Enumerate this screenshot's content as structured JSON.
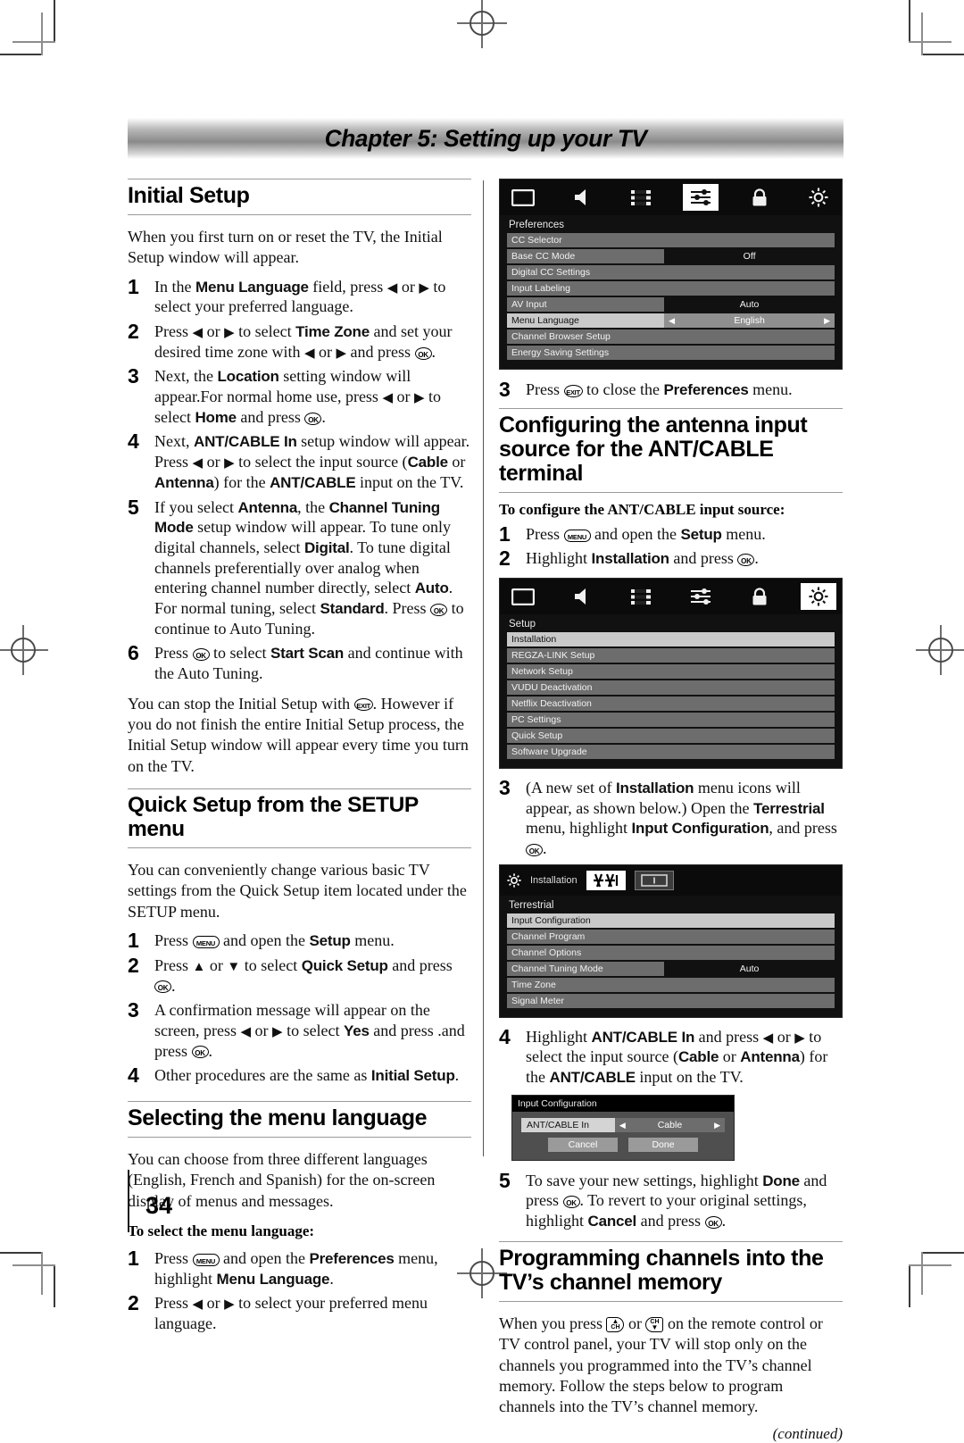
{
  "chapter": {
    "title": "Chapter 5: Setting up your TV"
  },
  "page": {
    "number": "34",
    "continued": "(continued)"
  },
  "left": {
    "section1": {
      "heading": "Initial Setup",
      "intro": "When you first turn on or reset the TV, the Initial Setup window will appear.",
      "steps": [
        {
          "n": "1",
          "html": "In the <b>Menu Language</b> field, press <span class=\"arrow\">◀</span> or <span class=\"arrow\">▶</span> to select  your preferred language."
        },
        {
          "n": "2",
          "html": "Press <span class=\"arrow\">◀</span> or <span class=\"arrow\">▶</span> to select <b>Time Zone</b> and set your desired time zone with <span class=\"arrow\">◀</span> or <span class=\"arrow\">▶</span> and press <span class=\"key ok\">OK</span>."
        },
        {
          "n": "3",
          "html": "Next, the <b>Location</b> setting window will appear.For normal home use, press <span class=\"arrow\">◀</span> or <span class=\"arrow\">▶</span> to select <b>Home</b> and press <span class=\"key ok\">OK</span>."
        },
        {
          "n": "4",
          "html": "Next, <b>ANT/CABLE In</b> setup window will appear. Press <span class=\"arrow\">◀</span> or <span class=\"arrow\">▶</span> to select the input source (<b>Cable</b> or <b>Antenna</b>) for the <b>ANT/CABLE</b> input on the TV."
        },
        {
          "n": "5",
          "html": "If you select <b>Antenna</b>, the <b>Channel Tuning Mode</b> setup window will appear. To tune only digital channels, select <b>Digital</b>. To tune digital channels preferentially over analog when entering channel number directly, select <b>Auto</b>. For normal tuning, select <b>Standard</b>. Press <span class=\"key ok\">OK</span> to continue to Auto Tuning."
        },
        {
          "n": "6",
          "html": "Press <span class=\"key ok\">OK</span> to select <b>Start Scan</b> and continue with the Auto Tuning."
        }
      ],
      "outro": "You can stop the Initial Setup with <span class=\"key exit\">EXIT</span>. However if you do not finish the entire Initial Setup process, the Initial Setup window will appear every time you turn on the TV."
    },
    "section2": {
      "heading": "Quick Setup from the SETUP menu",
      "intro": "You can conveniently change various basic TV settings from the Quick Setup item located under the SETUP menu.",
      "steps": [
        {
          "n": "1",
          "html": "Press <span class=\"key menu\">MENU</span> and open the <b>Setup</b> menu."
        },
        {
          "n": "2",
          "html": "Press <span class=\"arrow\">▲</span> or <span class=\"arrow\">▼</span> to select <b>Quick Setup</b> and press <span class=\"key ok\">OK</span>."
        },
        {
          "n": "3",
          "html": "A confirmation message will appear on the screen, press <span class=\"arrow\">◀</span> or <span class=\"arrow\">▶</span> to select <b>Yes</b> and press .and press <span class=\"key ok\">OK</span>."
        },
        {
          "n": "4",
          "html": "Other procedures are the same as <b>Initial Setup</b>."
        }
      ]
    },
    "section3": {
      "heading": "Selecting the menu language",
      "intro": "You can choose from three different languages (English, French and Spanish) for the on-screen display of menus and messages.",
      "subheading": "To select the menu language:",
      "steps": [
        {
          "n": "1",
          "html": "Press <span class=\"key menu\">MENU</span> and open the <b>Preferences</b> menu, highlight <b>Menu Language</b>."
        },
        {
          "n": "2",
          "html": "Press <span class=\"arrow\">◀</span> or <span class=\"arrow\">▶</span> to select your preferred menu language."
        }
      ]
    }
  },
  "right": {
    "preferences_osd": {
      "title": "Preferences",
      "icons": [
        "picture-icon",
        "sound-icon",
        "channel-icon",
        "preferences-icon",
        "locks-icon",
        "setup-icon"
      ],
      "selected_icon_index": 3,
      "rows": [
        {
          "label": "CC Selector",
          "value": ""
        },
        {
          "label": "Base CC Mode",
          "value": "Off"
        },
        {
          "label": "Digital CC Settings",
          "value": ""
        },
        {
          "label": "Input Labeling",
          "value": ""
        },
        {
          "label": "AV Input",
          "value": "Auto"
        },
        {
          "label": "Menu Language",
          "value": "English",
          "highlighted": true,
          "arrows": true
        },
        {
          "label": "Channel Browser Setup",
          "value": ""
        },
        {
          "label": "Energy Saving Settings",
          "value": ""
        }
      ]
    },
    "step3_prefs": {
      "n": "3",
      "html": "Press <span class=\"key exit\">EXIT</span> to close the <b>Preferences</b> menu."
    },
    "section_antenna": {
      "heading": "Configuring the antenna input source for the ANT/CABLE terminal",
      "subheading": "To configure the ANT/CABLE input source:",
      "steps": [
        {
          "n": "1",
          "html": "Press <span class=\"key menu\">MENU</span> and open the <b>Setup</b> menu."
        },
        {
          "n": "2",
          "html": "Highlight <b>Installation</b> and press <span class=\"key ok\">OK</span>."
        }
      ]
    },
    "setup_osd": {
      "title": "Setup",
      "icons": [
        "picture-icon",
        "sound-icon",
        "channel-icon",
        "preferences-icon",
        "locks-icon",
        "setup-icon"
      ],
      "selected_icon_index": 5,
      "rows": [
        {
          "label": "Installation",
          "highlighted": true
        },
        {
          "label": "REGZA-LINK Setup"
        },
        {
          "label": "Network Setup"
        },
        {
          "label": "VUDU Deactivation"
        },
        {
          "label": "Netflix Deactivation"
        },
        {
          "label": "PC Settings"
        },
        {
          "label": "Quick Setup"
        },
        {
          "label": "Software Upgrade"
        }
      ]
    },
    "step3_install": {
      "n": "3",
      "html": "(A new set of <b>Installation</b> menu icons will appear, as shown below.) Open the <b>Terrestrial</b> menu, highlight <b>Input Configuration</b>, and press <span class=\"key ok\">OK</span>."
    },
    "installation_osd": {
      "header_label": "Installation",
      "header_icons": [
        "antenna-icon",
        "input-icon"
      ],
      "selected_header_icon_index": 0,
      "title": "Terrestrial",
      "rows": [
        {
          "label": "Input Configuration",
          "value": "",
          "highlighted": true
        },
        {
          "label": "Channel Program",
          "value": ""
        },
        {
          "label": "Channel Options",
          "value": ""
        },
        {
          "label": "Channel Tuning Mode",
          "value": "Auto"
        },
        {
          "label": "Time Zone",
          "value": ""
        },
        {
          "label": "Signal Meter",
          "value": ""
        }
      ]
    },
    "step4_antcable": {
      "n": "4",
      "html": "Highlight <b>ANT/CABLE In</b> and press <span class=\"arrow\">◀</span> or <span class=\"arrow\">▶</span> to select the input source (<b>Cable</b> or <b>Antenna</b>) for the <b>ANT/CABLE</b> input on the TV."
    },
    "input_config_dialog": {
      "title": "Input Configuration",
      "field_label": "ANT/CABLE In",
      "field_value": "Cable",
      "cancel_label": "Cancel",
      "done_label": "Done"
    },
    "step5_save": {
      "n": "5",
      "html": "To save your new settings, highlight <b>Done</b> and press <span class=\"key ok\">OK</span>. To revert to your original settings, highlight <b>Cancel</b> and press <span class=\"key ok\">OK</span>."
    },
    "section_programming": {
      "heading": "Programming channels into the TV’s channel memory",
      "body": "When you press <span class=\"key chup\"><span class=\"tri\">▲</span>CH</span> or <span class=\"key chdn\">CH<span class=\"tri\">▼</span></span> on the remote control or TV control panel, your TV will stop only on the channels you programmed into the TV’s channel memory. Follow the steps below to program channels into the TV’s channel memory."
    }
  }
}
